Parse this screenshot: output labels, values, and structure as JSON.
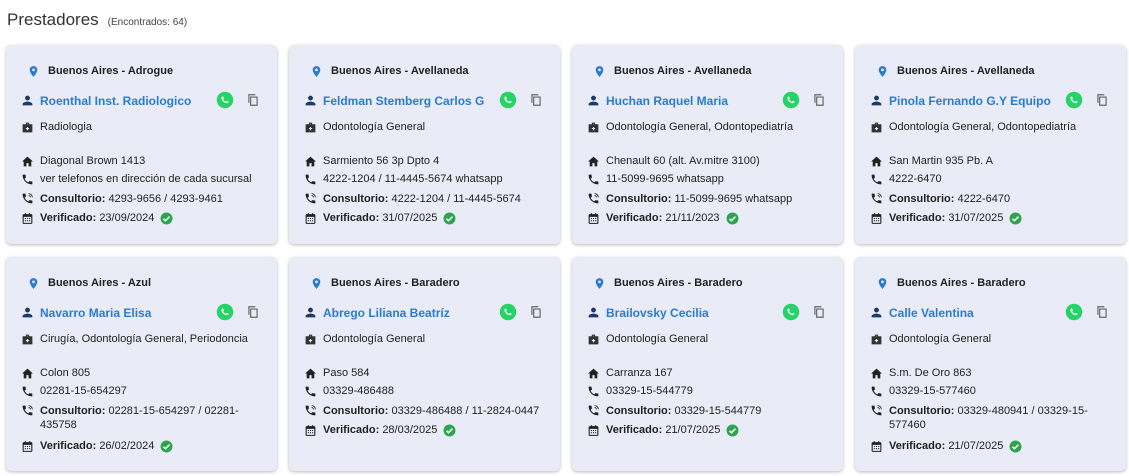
{
  "header": {
    "title": "Prestadores",
    "count": "(Encontrados: 64)"
  },
  "labels": {
    "consultorio": "Consultorio:",
    "verificado": "Verificado:"
  },
  "colors": {
    "link": "#2a7bd0",
    "whatsapp": "#25d366",
    "card_bg": "#e9ecf7",
    "verified": "#2ea44f"
  },
  "cards": [
    {
      "location": "Buenos Aires - Adrogue",
      "name": "Roenthal Inst. Radiologico",
      "specialty": "Radiologia",
      "address": "Diagonal Brown 1413",
      "phone": "ver telefonos en dirección de cada sucursal",
      "consultorio": "4293-9656 / 4293-9461",
      "verified": "23/09/2024"
    },
    {
      "location": "Buenos Aires - Avellaneda",
      "name": "Feldman Stemberg Carlos G",
      "specialty": "Odontología General",
      "address": "Sarmiento 56 3p Dpto 4",
      "phone": "4222-1204 / 11-4445-5674 whatsapp",
      "consultorio": "4222-1204 / 11-4445-5674",
      "verified": "31/07/2025"
    },
    {
      "location": "Buenos Aires - Avellaneda",
      "name": "Huchan Raquel Maria",
      "specialty": "Odontología General, Odontopediatría",
      "address": "Chenault 60 (alt. Av.mitre 3100)",
      "phone": "11-5099-9695 whatsapp",
      "consultorio": "11-5099-9695 whatsapp",
      "verified": "21/11/2023"
    },
    {
      "location": "Buenos Aires - Avellaneda",
      "name": "Pinola Fernando G.Y Equipo",
      "specialty": "Odontología General, Odontopediatría",
      "address": "San Martin 935 Pb. A",
      "phone": "4222-6470",
      "consultorio": "4222-6470",
      "verified": "31/07/2025"
    },
    {
      "location": "Buenos Aires - Azul",
      "name": "Navarro Maria Elisa",
      "specialty": "Cirugía, Odontología General, Periodoncia",
      "address": "Colon 805",
      "phone": "02281-15-654297",
      "consultorio": "02281-15-654297 / 02281-435758",
      "verified": "26/02/2024",
      "tall": true
    },
    {
      "location": "Buenos Aires - Baradero",
      "name": "Abrego Liliana Beatríz",
      "specialty": "Odontología General",
      "address": "Paso 584",
      "phone": "03329-486488",
      "consultorio": "03329-486488 / 11-2824-0447",
      "verified": "28/03/2025"
    },
    {
      "location": "Buenos Aires - Baradero",
      "name": "Brailovsky Cecilia",
      "specialty": "Odontología General",
      "address": "Carranza 167",
      "phone": "03329-15-544779",
      "consultorio": "03329-15-544779",
      "verified": "21/07/2025"
    },
    {
      "location": "Buenos Aires - Baradero",
      "name": "Calle Valentina",
      "specialty": "Odontología General",
      "address": "S.m. De Oro 863",
      "phone": "03329-15-577460",
      "consultorio": "03329-480941 / 03329-15-577460",
      "verified": "21/07/2025",
      "tall": true
    }
  ]
}
